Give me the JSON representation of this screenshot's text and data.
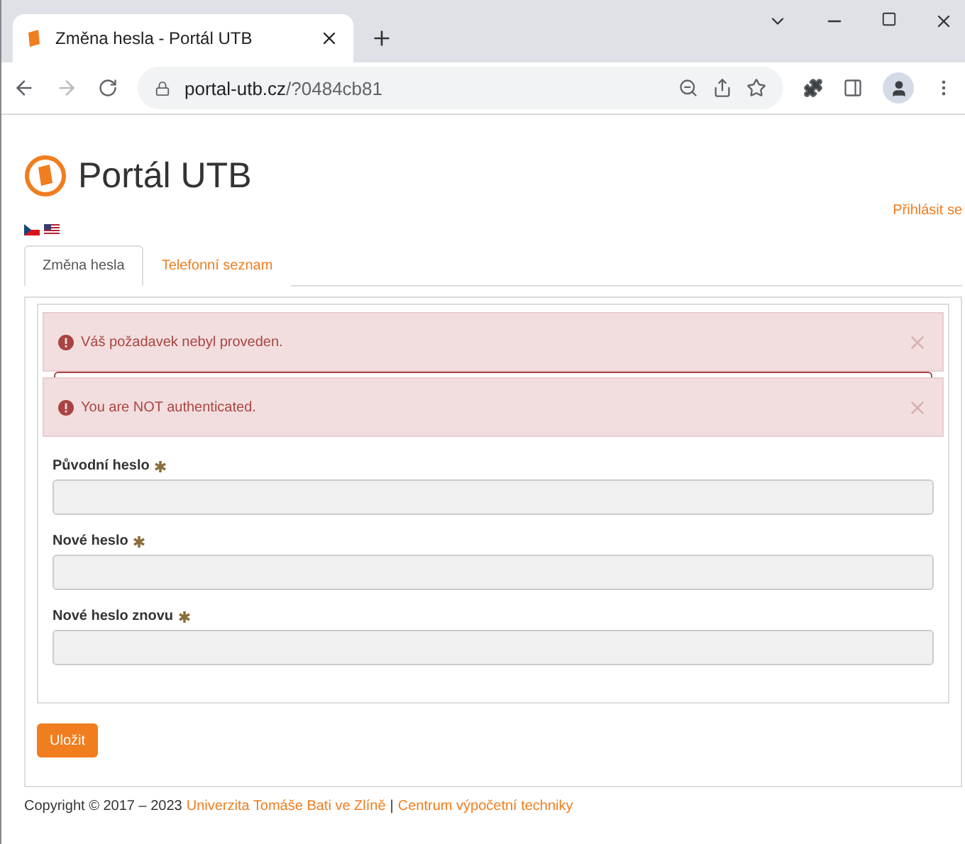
{
  "browser": {
    "tab_title": "Změna hesla - Portál UTB",
    "url_host": "portal-utb.cz",
    "url_path": "/?0484cb81"
  },
  "header": {
    "title": "Portál UTB",
    "login_link": "Přihlásit se"
  },
  "languages": [
    {
      "kind": "cz"
    },
    {
      "kind": "us"
    }
  ],
  "tabs": [
    {
      "label": "Změna hesla",
      "selected": true
    },
    {
      "label": "Telefonní seznam",
      "selected": false
    }
  ],
  "alerts": [
    {
      "message": "Váš požadavek nebyl proveden."
    },
    {
      "message": "You are NOT authenticated."
    }
  ],
  "fields": [
    {
      "label": "Původní heslo",
      "required": true
    },
    {
      "label": "Nové heslo",
      "required": true
    },
    {
      "label": "Nové heslo znovu",
      "required": true
    }
  ],
  "save_button": "Uložit",
  "footer": {
    "copyright": "Copyright © 2017 – 2023",
    "link_1": "Univerzita Tomáše Bati ve Zlíně",
    "separator": "|",
    "link_2": "Centrum výpočetní techniky"
  }
}
